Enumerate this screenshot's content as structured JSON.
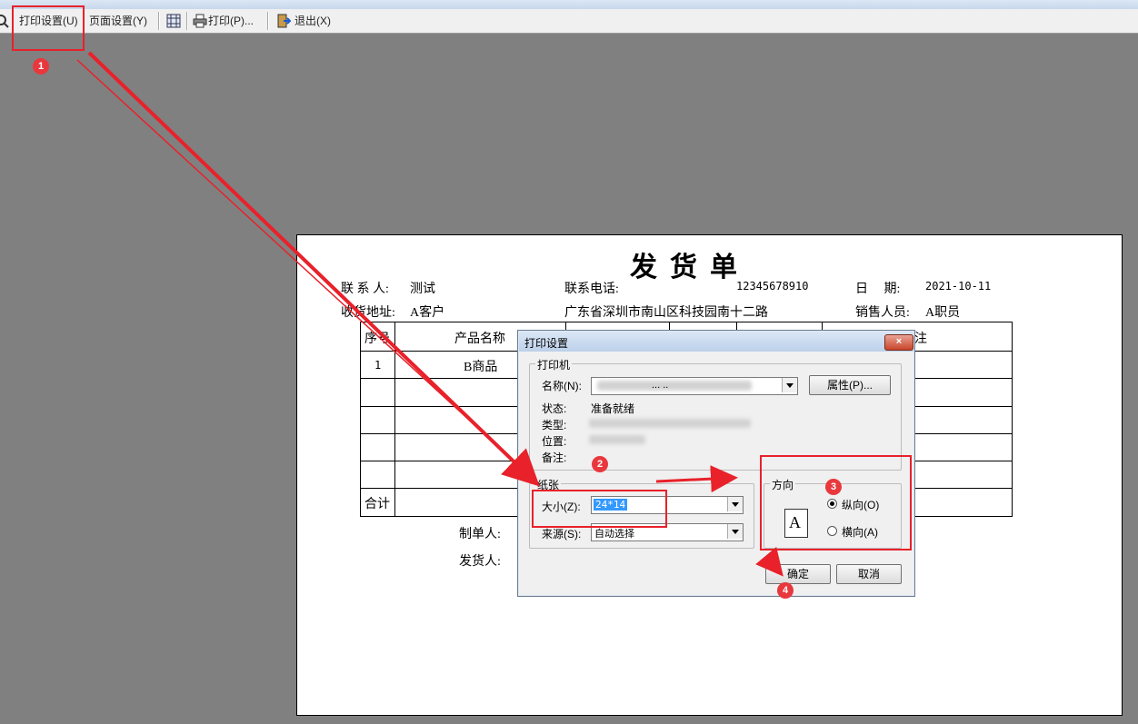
{
  "toolbar": {
    "print_setup": "打印设置(U)",
    "page_setup": "页面设置(Y)",
    "print": "打印(P)...",
    "exit": "退出(X)"
  },
  "paper": {
    "title": "发货单",
    "contact_label": "联 系 人:",
    "contact_value": "测试",
    "phone_label": "联系电话:",
    "phone_value": "12345678910",
    "date_label": "日　 期:",
    "date_value": "2021-10-11",
    "address_label": "收货地址:",
    "address_value": "A客户",
    "address_detail": "广东省深圳市南山区科技园南十二路",
    "sales_label": "销售人员:",
    "sales_value": "A职员",
    "col_seq": "序号",
    "col_product": "产品名称",
    "col_remark": "注",
    "row1_seq": "1",
    "row1_product": "B商品",
    "total_label": "合计",
    "maker_label": "制单人:",
    "shipper_label": "发货人:"
  },
  "dialog": {
    "title": "打印设置",
    "close": "×",
    "printer_group": "打印机",
    "name_label": "名称(N):",
    "name_value": "... ..",
    "properties_btn": "属性(P)...",
    "status_label": "状态:",
    "status_value": "准备就绪",
    "type_label": "类型:",
    "location_label": "位置:",
    "comment_label": "备注:",
    "paper_group": "纸张",
    "size_label": "大小(Z):",
    "size_value": "24*14",
    "source_label": "来源(S):",
    "source_value": "自动选择",
    "orient_group": "方向",
    "portrait": "纵向(O)",
    "landscape": "横向(A)",
    "orient_icon_letter": "A",
    "ok": "确定",
    "cancel": "取消"
  },
  "annotations": [
    "1",
    "2",
    "3",
    "4"
  ],
  "colors": {
    "annotation": "#e8212a",
    "workspace": "#808080"
  }
}
